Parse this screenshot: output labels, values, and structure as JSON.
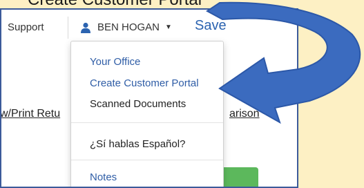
{
  "caption": "Create Customer Portal",
  "header": {
    "support_label": "Support",
    "user_name": "BEN HOGAN",
    "save_label": "Save"
  },
  "background": {
    "left_link": "w/Print Retu",
    "right_link": "arison"
  },
  "menu": {
    "items": [
      {
        "label": "Your Office"
      },
      {
        "label": "Create Customer Portal"
      },
      {
        "label": "Scanned Documents"
      },
      {
        "label": "¿Sí hablas Español?"
      },
      {
        "label": "Notes"
      }
    ]
  },
  "colors": {
    "background": "#fdf0c4",
    "link": "#2f5da6",
    "arrow": "#3b6bbf",
    "button": "#5cb85c"
  }
}
